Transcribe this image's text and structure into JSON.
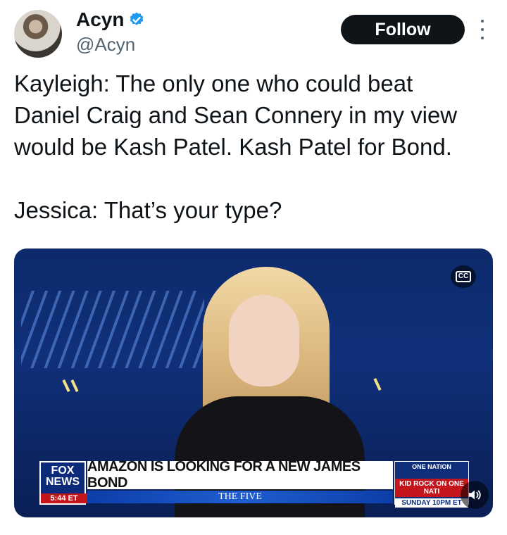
{
  "author": {
    "name": "Acyn",
    "handle": "@Acyn",
    "verified": true,
    "verified_color": "#1d9bf0"
  },
  "actions": {
    "follow_label": "Follow",
    "more_icon": "more-vertical-icon"
  },
  "tweet": {
    "text": "Kayleigh: The only one who could beat\nDaniel Craig and Sean Connery in my view\nwould be Kash Patel. Kash Patel for Bond.\n\nJessica: That’s your type?"
  },
  "media": {
    "cc_label": "CC",
    "volume_icon": "volume-icon",
    "lower_third": {
      "network_line1": "FOX",
      "network_line2": "NEWS",
      "time": "5:44 ET",
      "headline": "AMAZON IS LOOKING FOR A NEW JAMES BOND",
      "show": "THE FIVE",
      "promo_title": "ONE NATION",
      "promo_line1": "KID ROCK ON ONE NATI",
      "promo_line2": "SUNDAY 10PM ET"
    }
  },
  "colors": {
    "text_primary": "#0f1419",
    "text_secondary": "#536471",
    "follow_bg": "#0f1419",
    "follow_text": "#ffffff"
  }
}
